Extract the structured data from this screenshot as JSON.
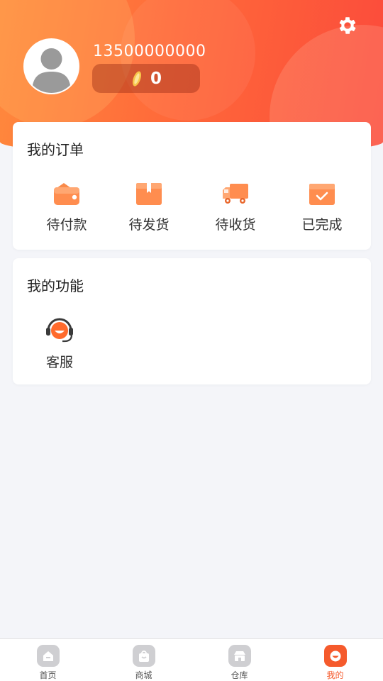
{
  "header": {
    "phone": "13500000000",
    "coins": "0",
    "avatar_icon": "user-avatar-icon",
    "settings_icon": "gear-icon",
    "colors": {
      "gradient_start": "#ff8a3d",
      "gradient_end": "#fb4a3b"
    }
  },
  "orders": {
    "title": "我的订单",
    "items": [
      {
        "label": "待付款",
        "icon": "wallet-icon"
      },
      {
        "label": "待发货",
        "icon": "box-icon"
      },
      {
        "label": "待收货",
        "icon": "truck-icon"
      },
      {
        "label": "已完成",
        "icon": "done-box-icon"
      }
    ]
  },
  "functions": {
    "title": "我的功能",
    "items": [
      {
        "label": "客服",
        "icon": "headset-icon"
      }
    ]
  },
  "tabbar": {
    "active_color": "#f55a2c",
    "items": [
      {
        "label": "首页",
        "icon": "home-icon",
        "active": false
      },
      {
        "label": "商城",
        "icon": "shopping-bag-icon",
        "active": false
      },
      {
        "label": "仓库",
        "icon": "warehouse-icon",
        "active": false
      },
      {
        "label": "我的",
        "icon": "profile-icon",
        "active": true
      }
    ]
  }
}
